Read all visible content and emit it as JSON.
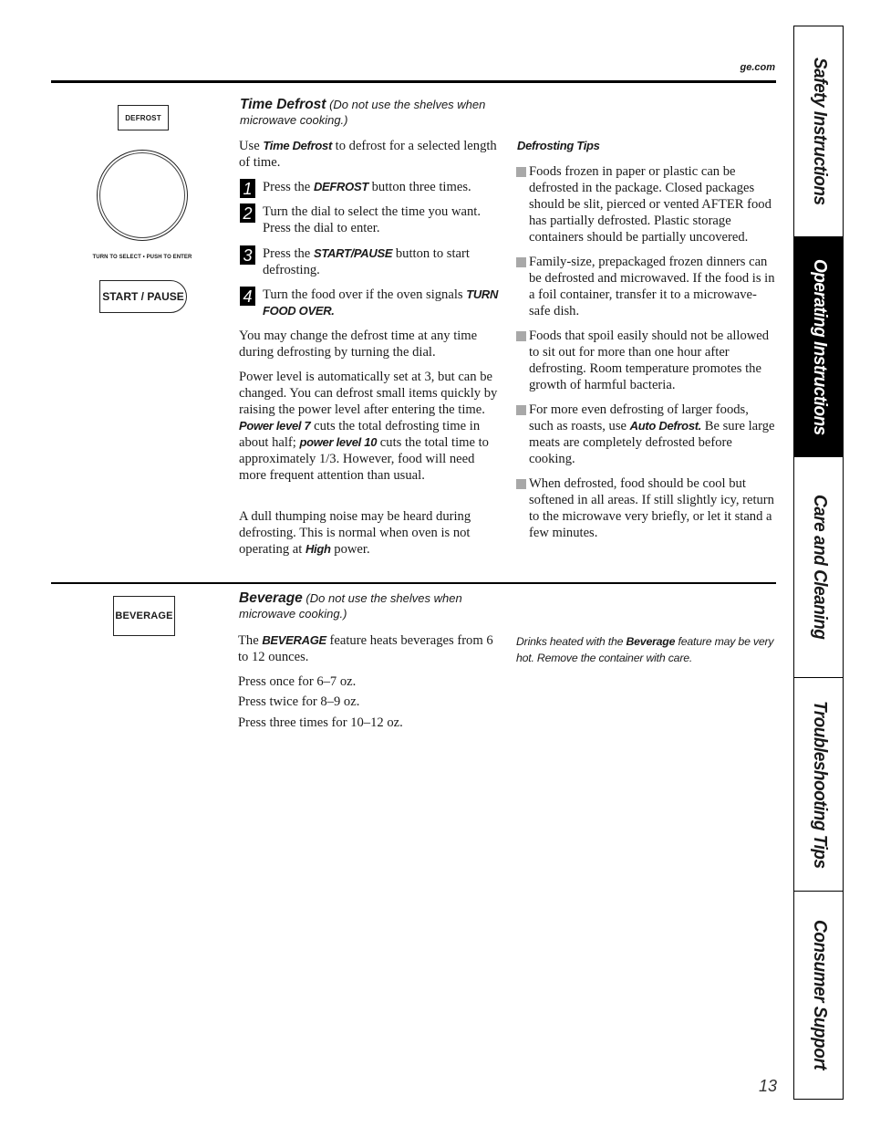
{
  "header": {
    "site": "ge.com"
  },
  "controls": {
    "defrost_button": "DEFROST",
    "dial_caption": "TURN TO SELECT  •  PUSH TO ENTER",
    "start_pause_button": "START / PAUSE",
    "beverage_button": "BEVERAGE"
  },
  "time_defrost": {
    "title": "Time Defrost",
    "subtitle": "(Do not use the shelves when microwave cooking.)",
    "intro": {
      "pre": "Use ",
      "bold": "Time Defrost",
      "post": " to defrost for a selected length of time."
    },
    "steps": [
      {
        "num": "1",
        "pre": "Press the ",
        "bold": "DEFROST",
        "post": " button three times."
      },
      {
        "num": "2",
        "pre": "Turn the dial to select the time you want. Press the dial to enter.",
        "bold": "",
        "post": ""
      },
      {
        "num": "3",
        "pre": "Press the ",
        "bold": "START/PAUSE",
        "post": " button to start defrosting."
      },
      {
        "num": "4",
        "pre": "Turn the food over if the oven signals ",
        "bold": "TURN FOOD OVER.",
        "post": ""
      }
    ],
    "para1": "You may change the defrost time at any time during defrosting by turning the dial.",
    "para2": {
      "a": "Power level is automatically set at 3, but can be changed. You can defrost small items quickly by raising the power level after entering the time. ",
      "b1": "Power level 7",
      "c": "  cuts the total defrosting time in about half; ",
      "b2": "power level 10",
      "d": "  cuts the total time to approximately 1/3. However, food will need more frequent attention than usual."
    },
    "para3": {
      "pre": "A dull thumping noise may be heard during defrosting. This is normal when oven is not operating at ",
      "bold": "High",
      "post": " power."
    }
  },
  "defrosting_tips": {
    "title": "Defrosting Tips",
    "items": [
      {
        "pre": "Foods frozen in paper or plastic can be defrosted in the package. Closed packages should be slit, pierced or vented AFTER food has partially defrosted. Plastic storage containers should be partially uncovered.",
        "bold": "",
        "post": ""
      },
      {
        "pre": "Family-size, prepackaged frozen dinners can be defrosted and microwaved. If the food is in a foil container, transfer it to a microwave-safe dish.",
        "bold": "",
        "post": ""
      },
      {
        "pre": "Foods that spoil easily should not be allowed to sit out for more than one hour after defrosting. Room temperature promotes the growth of harmful bacteria.",
        "bold": "",
        "post": ""
      },
      {
        "pre": "For more even defrosting of larger foods, such as roasts, use ",
        "bold": "Auto Defrost.",
        "post": " Be sure large meats are completely defrosted before cooking."
      },
      {
        "pre": "When defrosted, food should be cool but softened in all areas. If still slightly icy, return to the microwave very briefly, or let it stand a few minutes.",
        "bold": "",
        "post": ""
      }
    ]
  },
  "beverage": {
    "title": "Beverage",
    "subtitle": "(Do not use the shelves when microwave cooking.)",
    "intro": {
      "pre": "The ",
      "bold": "BEVERAGE",
      "post": " feature heats beverages from 6 to 12 ounces."
    },
    "lines": [
      "Press once for 6–7 oz.",
      "Press twice for 8–9 oz.",
      "Press three times for 10–12 oz."
    ],
    "note": {
      "pre": "Drinks heated with the ",
      "bold": "Beverage",
      "post": " feature may be very hot. Remove the container with care."
    }
  },
  "side_tabs": [
    {
      "label": "Safety Instructions",
      "active": false
    },
    {
      "label": "Operating Instructions",
      "active": true
    },
    {
      "label": "Care and Cleaning",
      "active": false
    },
    {
      "label": "Troubleshooting Tips",
      "active": false
    },
    {
      "label": "Consumer Support",
      "active": false
    }
  ],
  "page_number": "13"
}
